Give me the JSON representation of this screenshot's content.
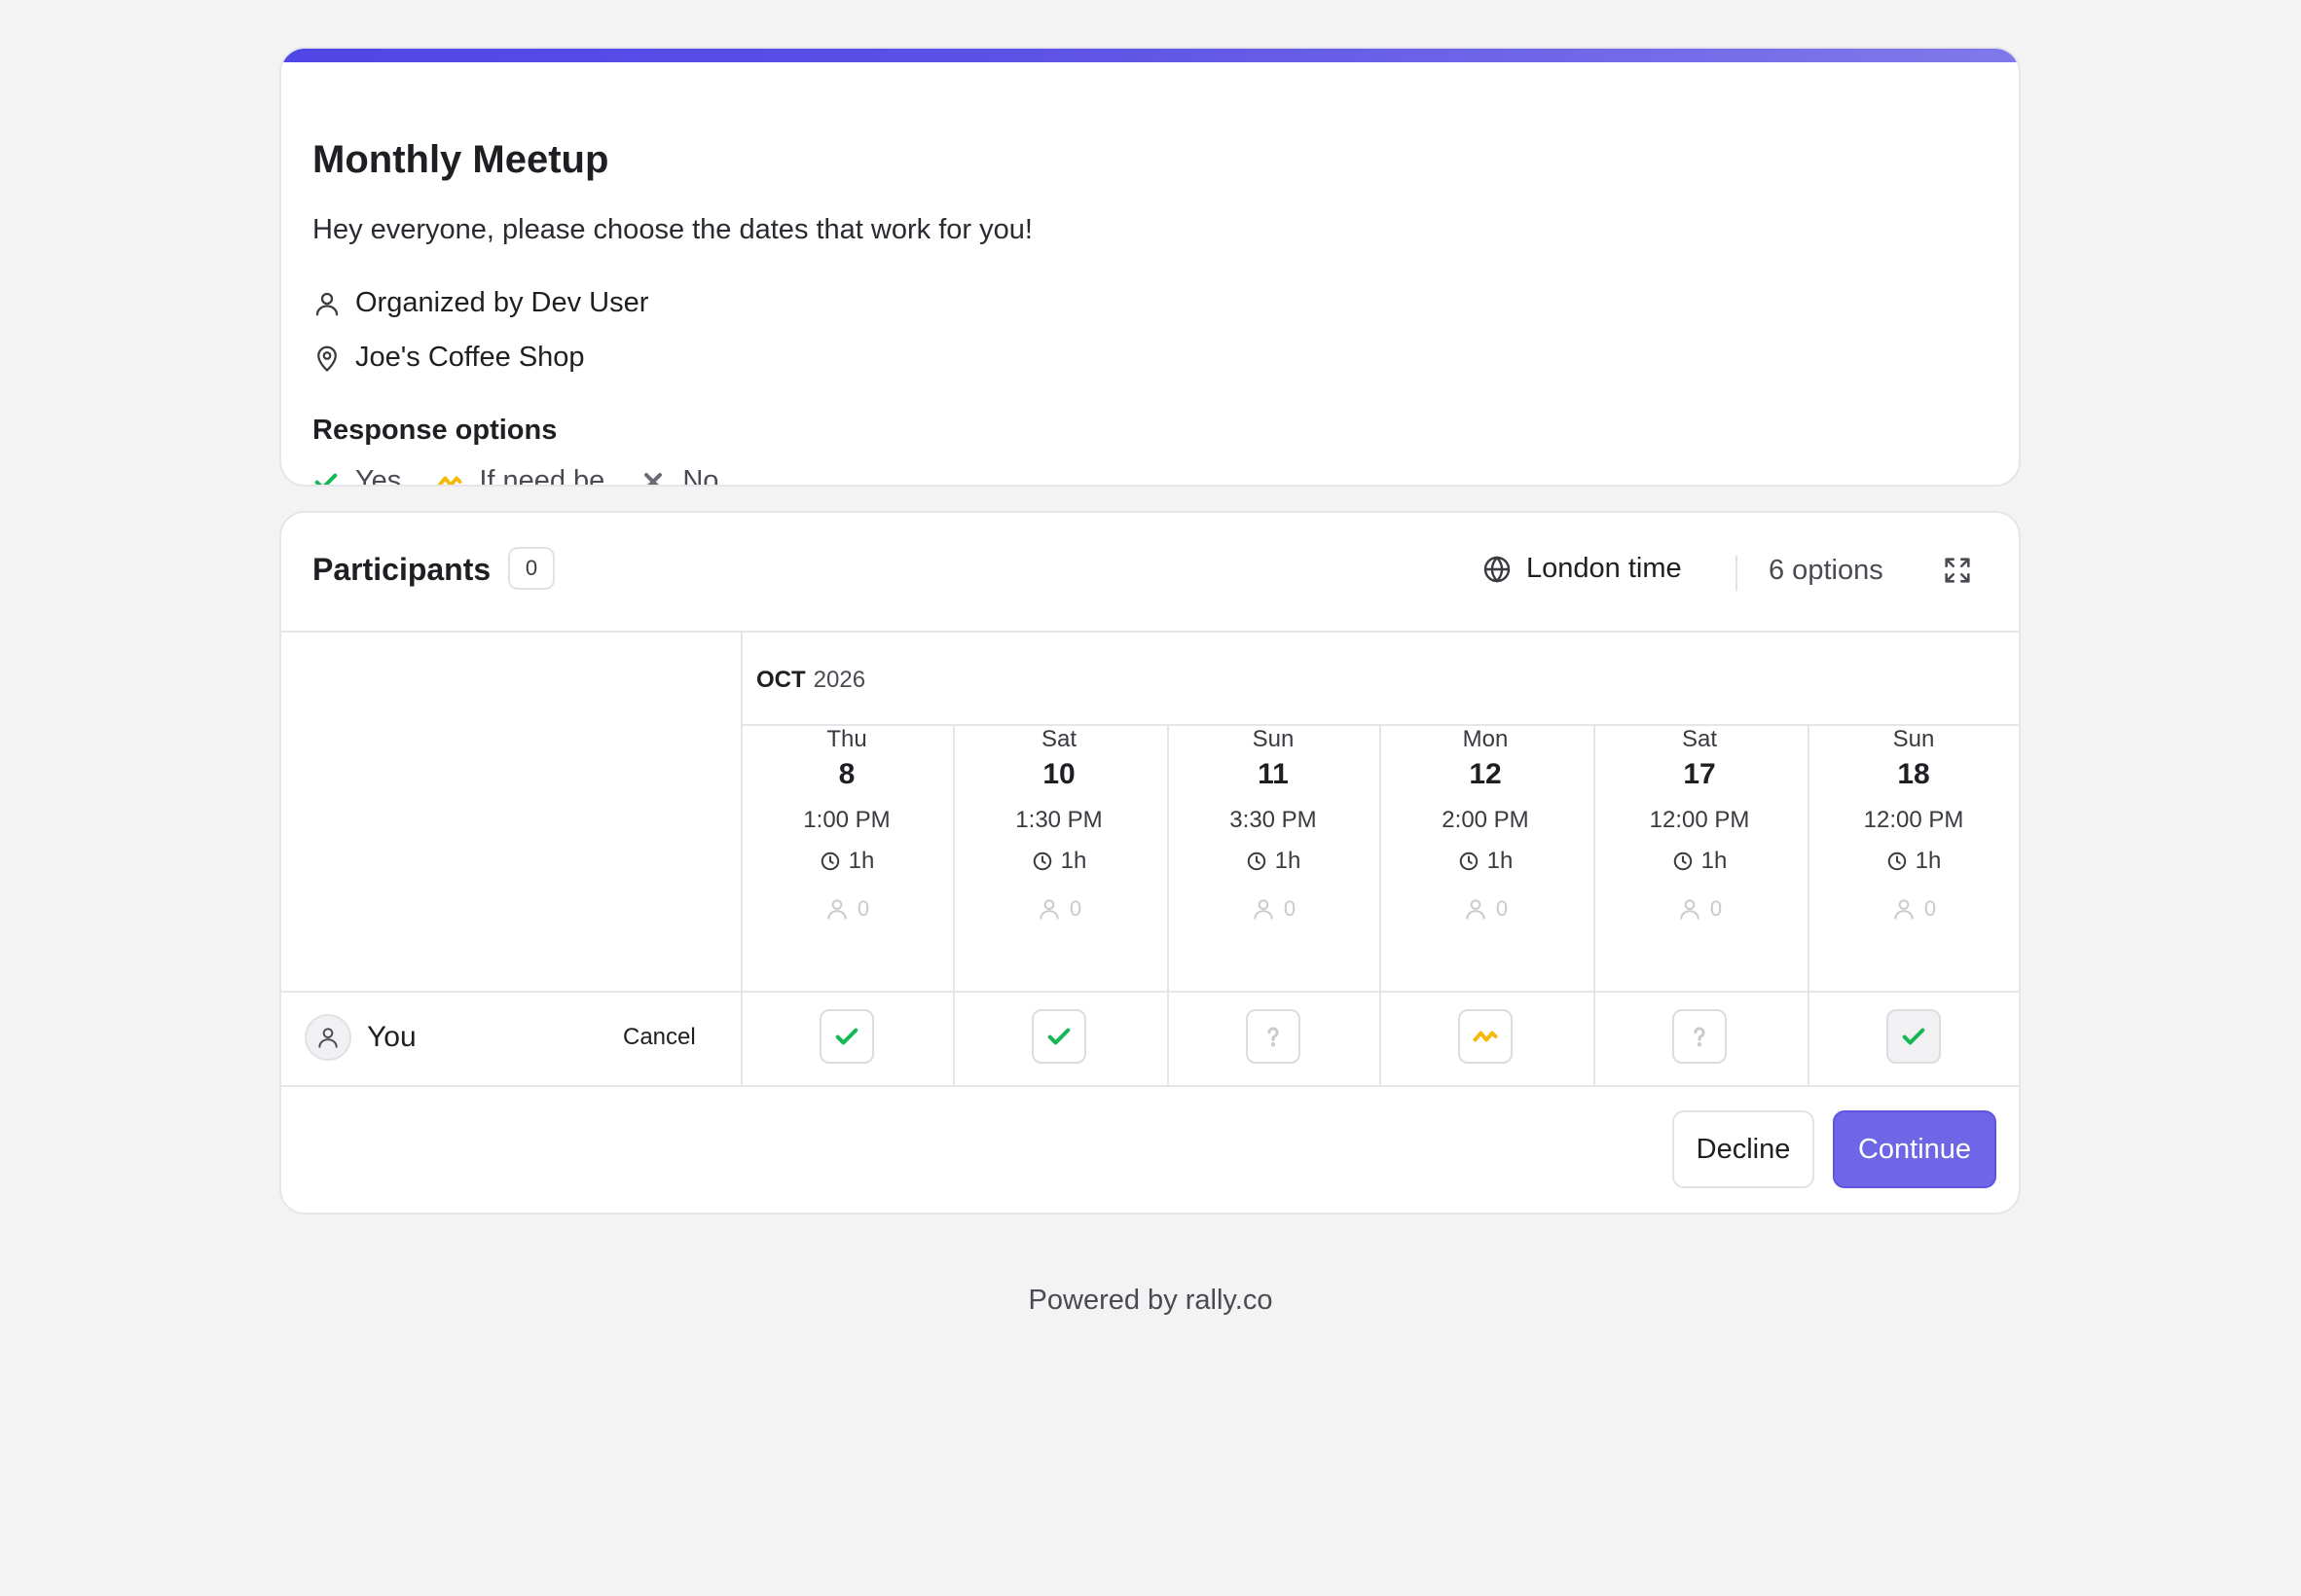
{
  "poll": {
    "title": "Monthly Meetup",
    "description": "Hey everyone, please choose the dates that work for you!",
    "organizer": "Organized by Dev User",
    "location": "Joe's Coffee Shop",
    "response_heading": "Response options",
    "response_options": {
      "yes": "Yes",
      "ifneedbe": "If need be",
      "no": "No"
    }
  },
  "participants": {
    "title": "Participants",
    "count": "0",
    "timezone": "London time",
    "options_count": "6 options",
    "month": "OCT",
    "year": "2026",
    "columns": [
      {
        "dow": "Thu",
        "day": "8",
        "time": "1:00 PM",
        "duration": "1h",
        "count": "0",
        "vote": "yes"
      },
      {
        "dow": "Sat",
        "day": "10",
        "time": "1:30 PM",
        "duration": "1h",
        "count": "0",
        "vote": "yes"
      },
      {
        "dow": "Sun",
        "day": "11",
        "time": "3:30 PM",
        "duration": "1h",
        "count": "0",
        "vote": "unknown"
      },
      {
        "dow": "Mon",
        "day": "12",
        "time": "2:00 PM",
        "duration": "1h",
        "count": "0",
        "vote": "ifneedbe"
      },
      {
        "dow": "Sat",
        "day": "17",
        "time": "12:00 PM",
        "duration": "1h",
        "count": "0",
        "vote": "unknown"
      },
      {
        "dow": "Sun",
        "day": "18",
        "time": "12:00 PM",
        "duration": "1h",
        "count": "0",
        "vote": "yes"
      }
    ],
    "you_label": "You",
    "cancel_label": "Cancel",
    "decline_label": "Decline",
    "continue_label": "Continue"
  },
  "colors": {
    "accent": "#6e66e7",
    "yes": "#16b755",
    "ifneedbe": "#f5b90a",
    "no": "#6b6b73"
  },
  "footer": {
    "text": "Powered by rally.co"
  }
}
